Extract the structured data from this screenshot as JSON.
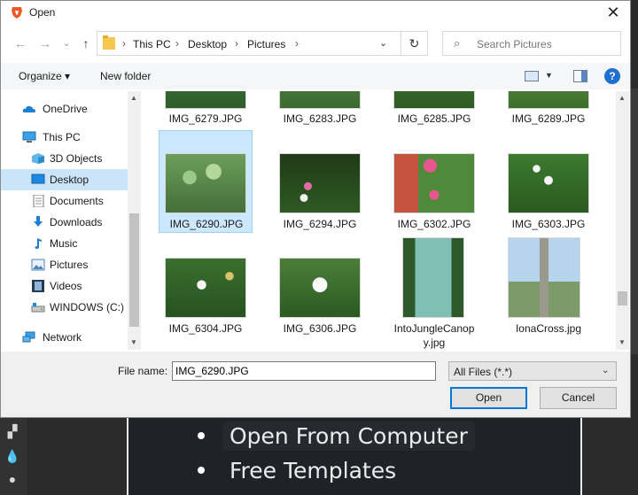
{
  "dialog": {
    "title": "Open",
    "close": "✕"
  },
  "nav": {
    "back": "←",
    "forward": "→",
    "history": "⌄",
    "up": "↑",
    "crumbs": [
      "This PC",
      "Desktop",
      "Pictures"
    ],
    "separator": "›",
    "refresh": "↻",
    "search_placeholder": "Search Pictures"
  },
  "toolbar": {
    "organize": "Organize ▾",
    "new_folder": "New folder",
    "view_dropdown": "▼",
    "help": "?"
  },
  "sidebar": {
    "items": [
      {
        "label": "OneDrive",
        "icon": "cloud-icon"
      },
      {
        "label": "This PC",
        "icon": "computer-icon"
      },
      {
        "label": "3D Objects",
        "icon": "cube-icon"
      },
      {
        "label": "Desktop",
        "icon": "desktop-icon",
        "selected": true
      },
      {
        "label": "Documents",
        "icon": "document-icon"
      },
      {
        "label": "Downloads",
        "icon": "download-icon"
      },
      {
        "label": "Music",
        "icon": "music-icon"
      },
      {
        "label": "Pictures",
        "icon": "pictures-icon"
      },
      {
        "label": "Videos",
        "icon": "video-icon"
      },
      {
        "label": "WINDOWS (C:)",
        "icon": "drive-icon"
      },
      {
        "label": "Network",
        "icon": "network-icon"
      }
    ]
  },
  "files": [
    {
      "name": "IMG_6279.JPG"
    },
    {
      "name": "IMG_6283.JPG"
    },
    {
      "name": "IMG_6285.JPG"
    },
    {
      "name": "IMG_6289.JPG"
    },
    {
      "name": "IMG_6290.JPG",
      "selected": true
    },
    {
      "name": "IMG_6294.JPG"
    },
    {
      "name": "IMG_6302.JPG"
    },
    {
      "name": "IMG_6303.JPG"
    },
    {
      "name": "IMG_6304.JPG"
    },
    {
      "name": "IMG_6306.JPG"
    },
    {
      "name_line1": "IntoJungleCanop",
      "name_line2": "y.jpg"
    },
    {
      "name": "IonaCross.jpg"
    }
  ],
  "footer": {
    "file_name_label": "File name:",
    "file_name_value": "IMG_6290.JPG",
    "filter_value": "All Files (*.*)",
    "open_label": "Open",
    "cancel_label": "Cancel"
  },
  "background": {
    "items": [
      "Open From Computer",
      "Free Templates"
    ]
  }
}
